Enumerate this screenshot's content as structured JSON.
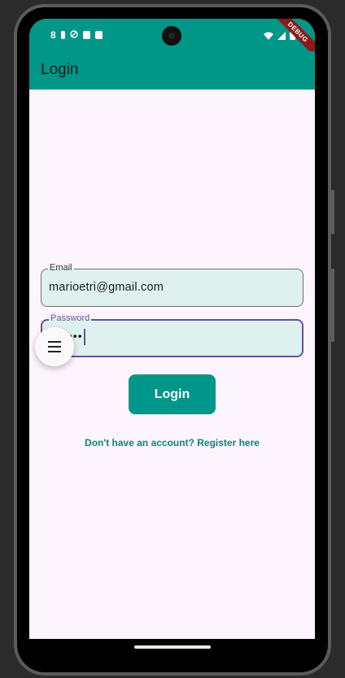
{
  "status_bar": {
    "time": "8",
    "debug_ribbon": "DEBUG"
  },
  "app_bar": {
    "title": "Login"
  },
  "form": {
    "email_label": "Email",
    "email_value": "marioetri@gmail.com",
    "password_label": "Password",
    "password_masked": "••••"
  },
  "login_button": "Login",
  "register_link": "Don't have an account? Register here",
  "icons": [
    "wifi-icon",
    "signal-icon",
    "battery-icon",
    "menu-icon",
    "camera-icon"
  ],
  "colors": {
    "primary": "#009688",
    "field_bg": "#dff1ef",
    "focus": "#6a4fa0",
    "background": "#fdf5fd"
  }
}
